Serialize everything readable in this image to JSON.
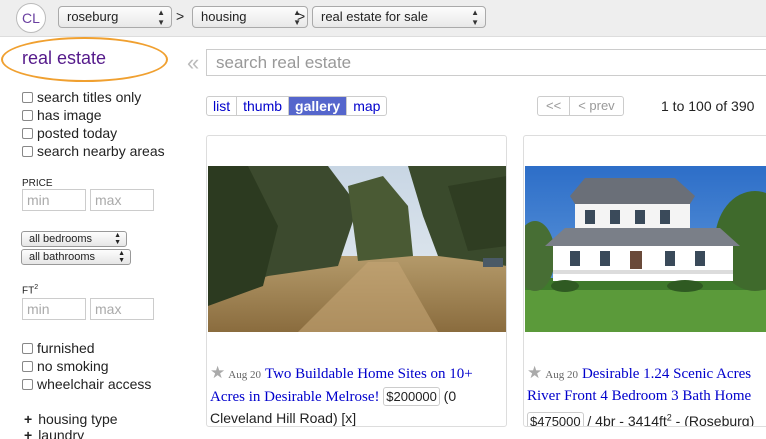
{
  "header": {
    "logo": "CL",
    "city": "roseburg",
    "section": "housing",
    "subsection": "real estate for sale",
    "separator": ">"
  },
  "sidebar": {
    "title": "real estate",
    "checkboxes": [
      "search titles only",
      "has image",
      "posted today",
      "search nearby areas"
    ],
    "price_label": "PRICE",
    "price_min_placeholder": "min",
    "price_max_placeholder": "max",
    "bedrooms": "all bedrooms",
    "bathrooms": "all bathrooms",
    "ft_label": "FT",
    "ft_sup": "2",
    "ft_min_placeholder": "min",
    "ft_max_placeholder": "max",
    "amenities": [
      "furnished",
      "no smoking",
      "wheelchair access"
    ],
    "expanders": [
      "housing type",
      "laundry"
    ]
  },
  "search": {
    "placeholder": "search real estate",
    "collapse_glyph": "«"
  },
  "views": [
    "list",
    "thumb",
    "gallery",
    "map"
  ],
  "active_view": "gallery",
  "pager": {
    "first": "<<",
    "prev": "< prev",
    "range": "1 to 100 of 390"
  },
  "listings": [
    {
      "date": "Aug 20",
      "title": "Two Buildable Home Sites on 10+ Acres in Desirable Melrose!",
      "price": "$200000",
      "meta": "(0 Cleveland Hill Road)",
      "hide": "[x]"
    },
    {
      "date": "Aug 20",
      "title": "Desirable 1.24 Scenic Acres River Front 4 Bedroom 3 Bath Home",
      "price": "$475000",
      "meta_prefix": "/ 4br - 3414ft",
      "meta_sup": "2",
      "meta_suffix": " - (Roseburg)"
    }
  ],
  "colors": {
    "accent_link": "#0000cc",
    "title_purple": "#551a8b",
    "highlight_oval": "#f0a030",
    "active_tab": "#5566cc"
  }
}
